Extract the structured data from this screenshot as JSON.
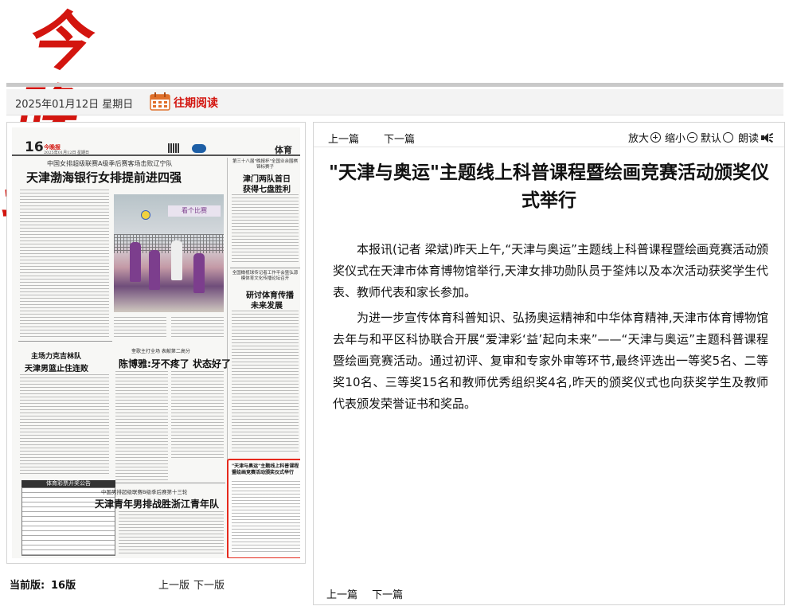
{
  "masthead": {
    "logo_text": "今晚报"
  },
  "datebar": {
    "date": "2025年01月12日 星期日",
    "past_reading": "往期阅读"
  },
  "thumbnail": {
    "page_number": "16",
    "section": "体育",
    "headlines": {
      "kicker1": "中国女排超级联赛A级季后赛客场击败辽宁队",
      "main1": "天津渤海银行女排提前进四强",
      "kicker2": "第三十八届\"晚报杯\"全国业余围棋锦标赛子",
      "right1a": "津门两队首日",
      "right1b": "获得七盘胜利",
      "kicker3": "全国橄榄球传记者工作平会暨弘源模体育文化传播论坛召开",
      "right2a": "研讨体育传播",
      "right2b": "未来发展",
      "left2a": "主场力克吉林队",
      "left2b": "天津男篮止住连败",
      "kicker4": "奎歌主打全场 表献第二高分",
      "mid2": "陈博雅:牙不疼了 状态好了",
      "kicker5": "中国男排超级联赛B级季后赛第十三轮",
      "bottom": "天津青年男排战胜浙江青年队",
      "table_title": "体育彩票开奖公告",
      "photo_banner": "看个比赛",
      "highlight_a": "\"天津与奥运\"主题线上科普课程",
      "highlight_b": "暨绘画竞赛活动颁奖仪式举行"
    }
  },
  "left_footer": {
    "current_label": "当前版:",
    "current_number": "16版",
    "prev": "上一版",
    "next": "下一版"
  },
  "article": {
    "toolbar": {
      "prev": "上一篇",
      "next": "下一篇",
      "zoom_in": "放大",
      "zoom_out": "缩小",
      "default": "默认",
      "read_aloud": "朗读"
    },
    "title": "\"天津与奥运\"主题线上科普课程暨绘画竞赛活动颁奖仪式举行",
    "paragraphs": [
      "本报讯(记者 梁斌)昨天上午,“天津与奥运”主题线上科普课程暨绘画竞赛活动颁奖仪式在天津市体育博物馆举行,天津女排功勋队员于筌炜以及本次活动获奖学生代表、教师代表和家长参加。",
      "为进一步宣传体育科普知识、弘扬奥运精神和中华体育精神,天津市体育博物馆去年与和平区科协联合开展“爱津彩‘益’起向未来”——“天津与奥运”主题科普课程暨绘画竞赛活动。通过初评、复审和专家外审等环节,最终评选出一等奖5名、二等奖10名、三等奖15名和教师优秀组织奖4名,昨天的颁奖仪式也向获奖学生及教师代表颁发荣誉证书和奖品。"
    ],
    "bottom_prev": "上一篇",
    "bottom_next": "下一篇"
  },
  "colors": {
    "brand_red": "#d3150f",
    "highlight_border": "#e62a1d"
  }
}
